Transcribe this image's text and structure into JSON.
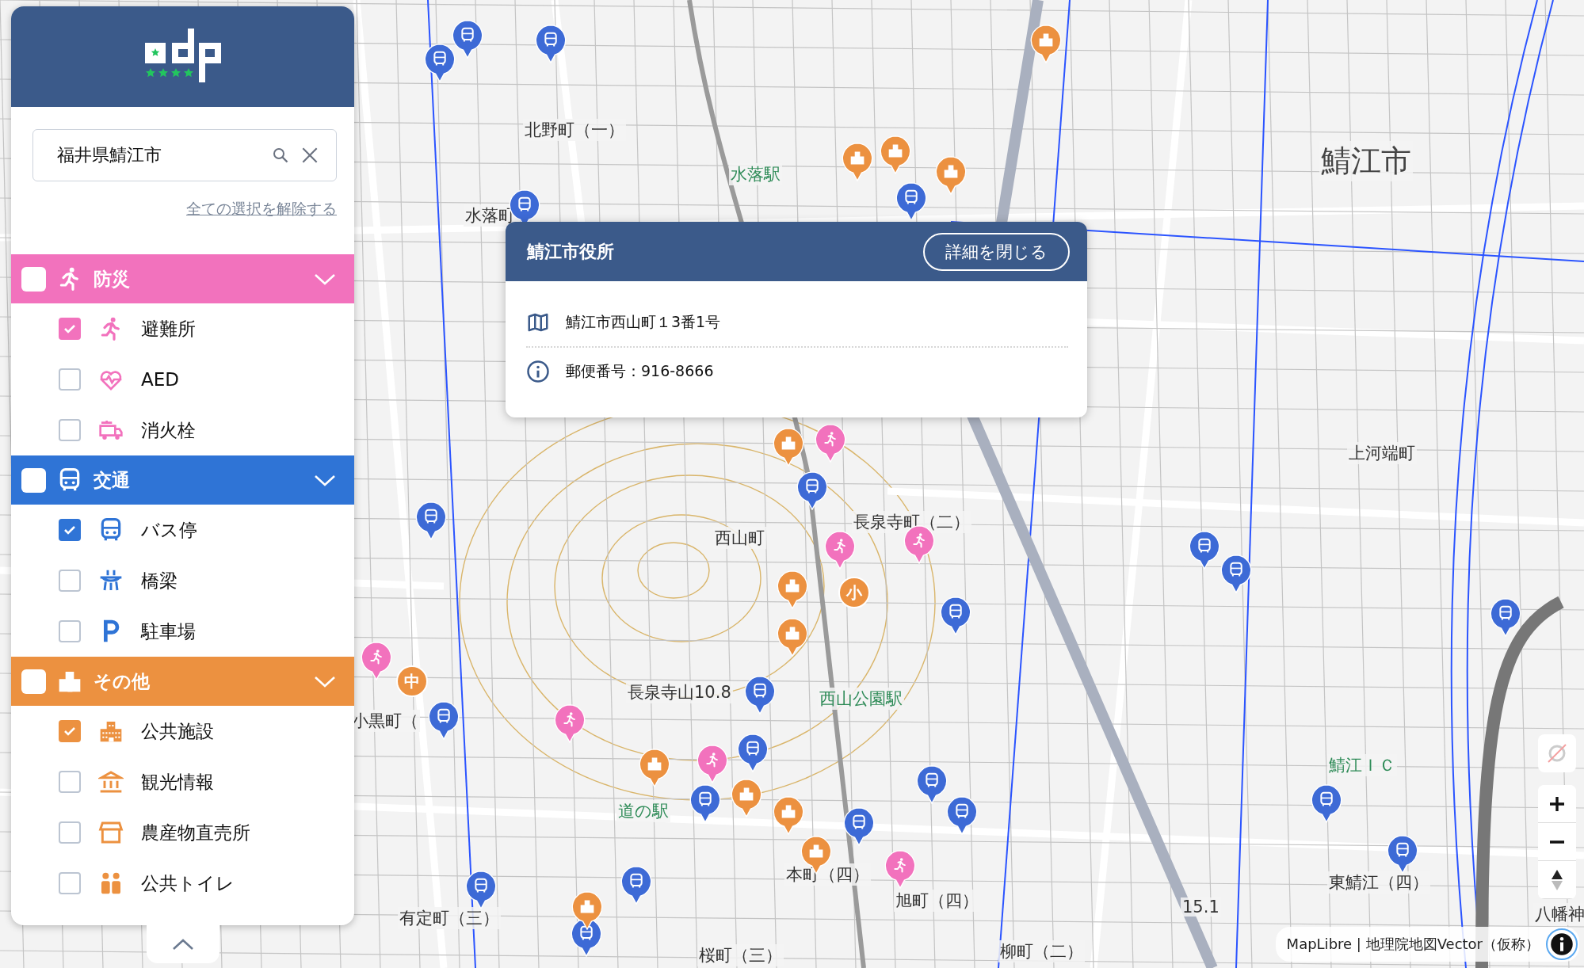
{
  "sidebar": {
    "search": {
      "value": "福井県鯖江市"
    },
    "clear_all_link": "全ての選択を解除する",
    "groups": [
      {
        "label": "防災",
        "color": "#f272bd",
        "checked": false,
        "expanded": true,
        "items": [
          {
            "label": "避難所",
            "checked": true
          },
          {
            "label": "AED",
            "checked": false
          },
          {
            "label": "消火栓",
            "checked": false
          }
        ]
      },
      {
        "label": "交通",
        "color": "#2f74d6",
        "checked": false,
        "expanded": true,
        "items": [
          {
            "label": "バス停",
            "checked": true
          },
          {
            "label": "橋梁",
            "checked": false
          },
          {
            "label": "駐車場",
            "checked": false
          }
        ]
      },
      {
        "label": "その他",
        "color": "#ec9140",
        "checked": false,
        "expanded": true,
        "items": [
          {
            "label": "公共施設",
            "checked": true
          },
          {
            "label": "観光情報",
            "checked": false
          },
          {
            "label": "農産物直売所",
            "checked": false
          },
          {
            "label": "公共トイレ",
            "checked": false
          }
        ]
      }
    ]
  },
  "popup": {
    "title": "鯖江市役所",
    "close_button": "詳細を閉じる",
    "rows": [
      {
        "kind": "address",
        "text": "鯖江市西山町１3番1号"
      },
      {
        "kind": "info",
        "text": "郵便番号：916-8666"
      }
    ]
  },
  "map": {
    "labels": [
      {
        "kind": "town",
        "text": "北野町（一）"
      },
      {
        "kind": "station",
        "text": "水落駅"
      },
      {
        "kind": "town",
        "text": "水落町"
      },
      {
        "kind": "city",
        "text": "鯖江市"
      },
      {
        "kind": "town",
        "text": "上河端町"
      },
      {
        "kind": "town",
        "text": "長泉寺町（二）"
      },
      {
        "kind": "town",
        "text": "西山町"
      },
      {
        "kind": "station",
        "text": "西山公園駅"
      },
      {
        "kind": "town",
        "text": "長泉寺山10.8"
      },
      {
        "kind": "town",
        "text": "小黒町（"
      },
      {
        "kind": "station",
        "text": "道の駅"
      },
      {
        "kind": "town",
        "text": "本町（四）"
      },
      {
        "kind": "town",
        "text": "旭町（四）"
      },
      {
        "kind": "town",
        "text": "有定町（三）"
      },
      {
        "kind": "town",
        "text": "桜町（三）"
      },
      {
        "kind": "town",
        "text": "柳町（二）"
      },
      {
        "kind": "station",
        "text": "鯖江ＩＣ"
      },
      {
        "kind": "town",
        "text": "東鯖江（四）"
      },
      {
        "kind": "town",
        "text": "八幡神"
      },
      {
        "kind": "town",
        "text": "15.1"
      }
    ],
    "badges": [
      {
        "text": "小"
      },
      {
        "text": "中"
      }
    ],
    "attribution": "MapLibre | 地理院地図Vector（仮称）"
  }
}
